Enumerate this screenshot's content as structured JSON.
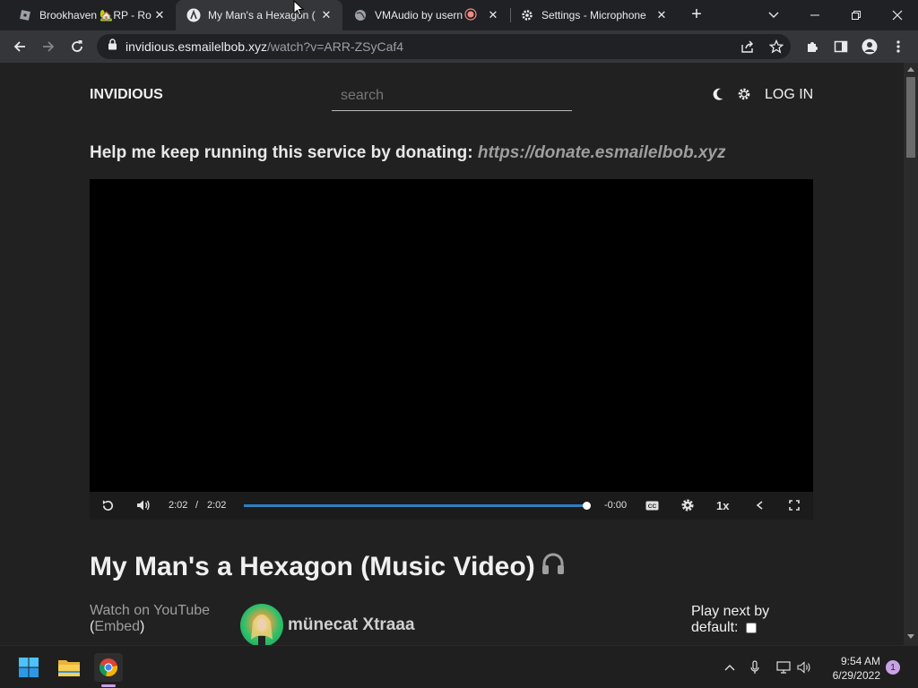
{
  "tabs": [
    {
      "title": "Brookhaven 🏡RP - Ro",
      "favicon": "roblox-icon",
      "active": false
    },
    {
      "title": "My Man's a Hexagon (",
      "favicon": "invidious-icon",
      "active": true
    },
    {
      "title": "VMAudio by usern",
      "favicon": "globe-icon",
      "active": false,
      "recording": true
    },
    {
      "title": "Settings - Microphone",
      "favicon": "settings-gear-icon",
      "active": false
    }
  ],
  "address_bar": {
    "host": "invidious.esmailelbob.xyz",
    "path": "/watch?v=ARR-ZSyCaf4"
  },
  "header": {
    "logo": "INVIDIOUS",
    "search_placeholder": "search",
    "login_label": "LOG IN"
  },
  "donate": {
    "text": "Help me keep running this service by donating: ",
    "link": "https://donate.esmailelbob.xyz"
  },
  "player": {
    "current_time": "2:02",
    "separator": "/",
    "duration": "2:02",
    "remaining": "-0:00",
    "speed": "1x",
    "progress_fraction": 1.0
  },
  "video": {
    "title": "My Man's a Hexagon (Music Video)",
    "watch_on_youtube": "Watch on YouTube",
    "embed_open": "(",
    "embed_label": "Embed",
    "embed_close": ")",
    "channel": "münecat Xtraaa",
    "play_next_label": "Play next by default:"
  },
  "taskbar": {
    "time": "9:54 AM",
    "date": "6/29/2022",
    "notification_count": "1"
  },
  "colors": {
    "accent": "#2e7fc2",
    "page_bg": "#212121",
    "chrome_bg": "#202124",
    "notif": "#c9a2e6"
  }
}
